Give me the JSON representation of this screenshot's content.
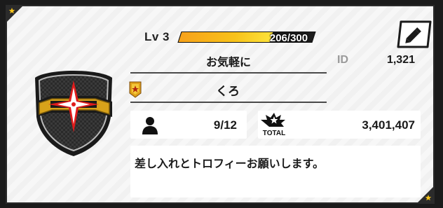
{
  "profile": {
    "level_label": "Lv 3",
    "xp_text": "206/300",
    "xp_current": 206,
    "xp_max": 300,
    "comment_text": "お気軽に",
    "id_label": "ID",
    "id_value": "1,321",
    "username": "くろ",
    "members": "9/12",
    "total_label": "TOTAL",
    "total_value": "3,401,407",
    "message": "差し入れとトロフィーお願いします。"
  },
  "icons": {
    "edit": "pencil-icon",
    "members": "person-icon",
    "total": "total-burst-icon",
    "rank": "rank-badge-icon",
    "emblem": "team-emblem-shield",
    "corner": "star-icon"
  },
  "colors": {
    "xp_fill": "#f8c21a",
    "frame": "#2b2b2b",
    "emblem_red": "#e01b1b",
    "emblem_gold": "#d8a21a"
  }
}
